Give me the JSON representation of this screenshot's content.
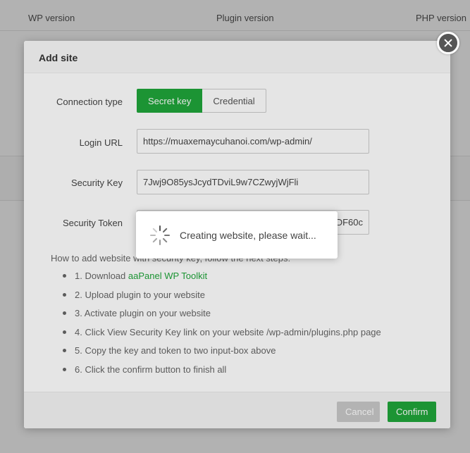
{
  "background": {
    "columns": [
      "WP version",
      "Plugin version",
      "PHP version"
    ]
  },
  "modal": {
    "title": "Add site",
    "connection_type": {
      "label": "Connection type",
      "options": [
        "Secret key",
        "Credential"
      ],
      "selected": "Secret key"
    },
    "login_url": {
      "label": "Login URL",
      "value": "https://muaxemaycuhanoi.com/wp-admin/"
    },
    "security_key": {
      "label": "Security Key",
      "value": "7Jwj9O85ysJcydTDviL9w7CZwyjWjFli"
    },
    "security_token": {
      "label": "Security Token",
      "value": "DF60c"
    },
    "help": {
      "intro": "How to add website with security key, follow the next steps:",
      "steps": {
        "s1_prefix": "1. Download ",
        "s1_link": "aaPanel WP Toolkit",
        "s2": "2. Upload plugin to your website",
        "s3": "3. Activate plugin on your website",
        "s4": "4. Click View Security Key link on your website /wp-admin/plugins.php page",
        "s5": "5. Copy the key and token to two input-box above",
        "s6": "6. Click the confirm button to finish all"
      }
    },
    "buttons": {
      "cancel": "Cancel",
      "confirm": "Confirm"
    }
  },
  "loading": {
    "message": "Creating website, please wait..."
  },
  "colors": {
    "accent": "#20a53a",
    "close_button": "#555555"
  }
}
